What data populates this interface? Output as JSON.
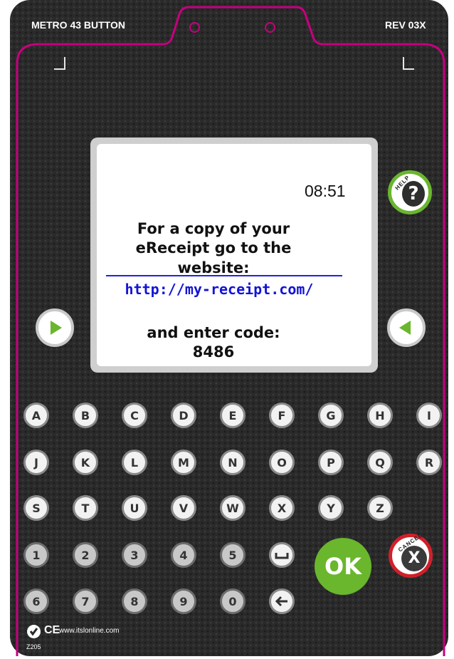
{
  "device": {
    "model": "METRO 43 BUTTON",
    "revision": "REV 03X",
    "colors": {
      "body": "#2a2a2a",
      "accent": "#c6007e",
      "ok": "#6ab62d",
      "cancel": "#d0202a",
      "help": "#6ab62d",
      "link": "#1313d6"
    }
  },
  "screen": {
    "time": "08:51",
    "message_lines": [
      "For a copy of your",
      "eReceipt go to the",
      "website:"
    ],
    "url": "http://my-receipt.com/",
    "code_prompt": "and enter code:",
    "code": "8486"
  },
  "buttons": {
    "help_label": "HELP",
    "help_symbol": "?",
    "ok_label": "OK",
    "cancel_label": "CANCEL",
    "cancel_symbol": "X",
    "left_arrow_icon": "green-right-arrow-icon",
    "right_arrow_icon": "green-left-arrow-icon"
  },
  "keypad": {
    "row1": [
      "A",
      "B",
      "C",
      "D",
      "E",
      "F",
      "G",
      "H",
      "I"
    ],
    "row2": [
      "J",
      "K",
      "L",
      "M",
      "N",
      "O",
      "P",
      "Q",
      "R"
    ],
    "row3": [
      "S",
      "T",
      "U",
      "V",
      "W",
      "X",
      "Y",
      "Z"
    ],
    "row4": [
      "1",
      "2",
      "3",
      "4",
      "5"
    ],
    "row5": [
      "6",
      "7",
      "8",
      "9",
      "0"
    ],
    "space_icon": "space-icon",
    "backspace_icon": "backspace-arrow-icon"
  },
  "footer": {
    "ce_mark": "CE",
    "website": "www.itslonline.com",
    "code": "Z205"
  }
}
